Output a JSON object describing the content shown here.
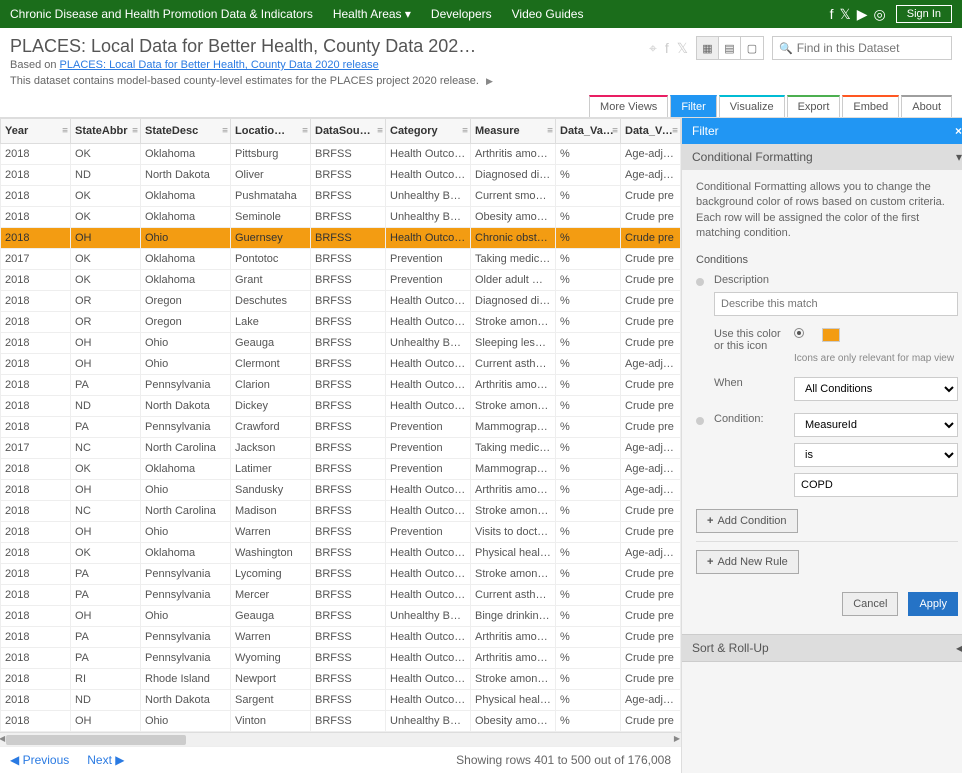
{
  "topnav": {
    "site_title": "Chronic Disease and Health Promotion Data & Indicators",
    "links": [
      "Health Areas",
      "Developers",
      "Video Guides"
    ],
    "signin": "Sign In"
  },
  "header": {
    "title": "PLACES: Local Data for Better Health, County Data 202…",
    "based_on_prefix": "Based on ",
    "based_on_link": "PLACES: Local Data for Better Health, County Data 2020 release",
    "description": "This dataset contains model-based county-level estimates for the PLACES project 2020 release.",
    "search_placeholder": "Find in this Dataset"
  },
  "tabs": {
    "more_views": "More Views",
    "filter": "Filter",
    "visualize": "Visualize",
    "export": "Export",
    "embed": "Embed",
    "about": "About"
  },
  "columns": [
    "Year",
    "StateAbbr",
    "StateDesc",
    "Locatio…",
    "DataSou…",
    "Category",
    "Measure",
    "Data_Va…",
    "Data_Va…"
  ],
  "rows": [
    {
      "c": [
        "2018",
        "OK",
        "Oklahoma",
        "Pittsburg",
        "BRFSS",
        "Health Outco…",
        "Arthritis amo…",
        "%",
        "Age-adjust"
      ]
    },
    {
      "c": [
        "2018",
        "ND",
        "North Dakota",
        "Oliver",
        "BRFSS",
        "Health Outco…",
        "Diagnosed di…",
        "%",
        "Age-adjust"
      ]
    },
    {
      "c": [
        "2018",
        "OK",
        "Oklahoma",
        "Pushmataha",
        "BRFSS",
        "Unhealthy Be…",
        "Current smo…",
        "%",
        "Crude pre"
      ]
    },
    {
      "c": [
        "2018",
        "OK",
        "Oklahoma",
        "Seminole",
        "BRFSS",
        "Unhealthy Be…",
        "Obesity amo…",
        "%",
        "Crude pre"
      ]
    },
    {
      "c": [
        "2018",
        "OH",
        "Ohio",
        "Guernsey",
        "BRFSS",
        "Health Outco…",
        "Chronic obst…",
        "%",
        "Crude pre"
      ],
      "hl": true
    },
    {
      "c": [
        "2017",
        "OK",
        "Oklahoma",
        "Pontotoc",
        "BRFSS",
        "Prevention",
        "Taking medic…",
        "%",
        "Crude pre"
      ]
    },
    {
      "c": [
        "2018",
        "OK",
        "Oklahoma",
        "Grant",
        "BRFSS",
        "Prevention",
        "Older adult …",
        "%",
        "Crude pre"
      ]
    },
    {
      "c": [
        "2018",
        "OR",
        "Oregon",
        "Deschutes",
        "BRFSS",
        "Health Outco…",
        "Diagnosed di…",
        "%",
        "Crude pre"
      ]
    },
    {
      "c": [
        "2018",
        "OR",
        "Oregon",
        "Lake",
        "BRFSS",
        "Health Outco…",
        "Stroke amon…",
        "%",
        "Crude pre"
      ]
    },
    {
      "c": [
        "2018",
        "OH",
        "Ohio",
        "Geauga",
        "BRFSS",
        "Unhealthy Be…",
        "Sleeping less …",
        "%",
        "Crude pre"
      ]
    },
    {
      "c": [
        "2018",
        "OH",
        "Ohio",
        "Clermont",
        "BRFSS",
        "Health Outco…",
        "Current asth…",
        "%",
        "Age-adjust"
      ]
    },
    {
      "c": [
        "2018",
        "PA",
        "Pennsylvania",
        "Clarion",
        "BRFSS",
        "Health Outco…",
        "Arthritis amo…",
        "%",
        "Crude pre"
      ]
    },
    {
      "c": [
        "2018",
        "ND",
        "North Dakota",
        "Dickey",
        "BRFSS",
        "Health Outco…",
        "Stroke amon…",
        "%",
        "Crude pre"
      ]
    },
    {
      "c": [
        "2018",
        "PA",
        "Pennsylvania",
        "Crawford",
        "BRFSS",
        "Prevention",
        "Mammograp…",
        "%",
        "Crude pre"
      ]
    },
    {
      "c": [
        "2017",
        "NC",
        "North Carolina",
        "Jackson",
        "BRFSS",
        "Prevention",
        "Taking medic…",
        "%",
        "Age-adjust"
      ]
    },
    {
      "c": [
        "2018",
        "OK",
        "Oklahoma",
        "Latimer",
        "BRFSS",
        "Prevention",
        "Mammograp…",
        "%",
        "Age-adjust"
      ]
    },
    {
      "c": [
        "2018",
        "OH",
        "Ohio",
        "Sandusky",
        "BRFSS",
        "Health Outco…",
        "Arthritis amo…",
        "%",
        "Age-adjust"
      ]
    },
    {
      "c": [
        "2018",
        "NC",
        "North Carolina",
        "Madison",
        "BRFSS",
        "Health Outco…",
        "Stroke amon…",
        "%",
        "Crude pre"
      ]
    },
    {
      "c": [
        "2018",
        "OH",
        "Ohio",
        "Warren",
        "BRFSS",
        "Prevention",
        "Visits to doct…",
        "%",
        "Crude pre"
      ]
    },
    {
      "c": [
        "2018",
        "OK",
        "Oklahoma",
        "Washington",
        "BRFSS",
        "Health Outco…",
        "Physical heal…",
        "%",
        "Age-adjust"
      ]
    },
    {
      "c": [
        "2018",
        "PA",
        "Pennsylvania",
        "Lycoming",
        "BRFSS",
        "Health Outco…",
        "Stroke amon…",
        "%",
        "Crude pre"
      ]
    },
    {
      "c": [
        "2018",
        "PA",
        "Pennsylvania",
        "Mercer",
        "BRFSS",
        "Health Outco…",
        "Current asth…",
        "%",
        "Crude pre"
      ]
    },
    {
      "c": [
        "2018",
        "OH",
        "Ohio",
        "Geauga",
        "BRFSS",
        "Unhealthy Be…",
        "Binge drinkin…",
        "%",
        "Crude pre"
      ]
    },
    {
      "c": [
        "2018",
        "PA",
        "Pennsylvania",
        "Warren",
        "BRFSS",
        "Health Outco…",
        "Arthritis amo…",
        "%",
        "Crude pre"
      ]
    },
    {
      "c": [
        "2018",
        "PA",
        "Pennsylvania",
        "Wyoming",
        "BRFSS",
        "Health Outco…",
        "Arthritis amo…",
        "%",
        "Crude pre"
      ]
    },
    {
      "c": [
        "2018",
        "RI",
        "Rhode Island",
        "Newport",
        "BRFSS",
        "Health Outco…",
        "Stroke amon…",
        "%",
        "Crude pre"
      ]
    },
    {
      "c": [
        "2018",
        "ND",
        "North Dakota",
        "Sargent",
        "BRFSS",
        "Health Outco…",
        "Physical heal…",
        "%",
        "Age-adjust"
      ]
    },
    {
      "c": [
        "2018",
        "OH",
        "Ohio",
        "Vinton",
        "BRFSS",
        "Unhealthy Be…",
        "Obesity amo…",
        "%",
        "Crude pre"
      ]
    }
  ],
  "pagination": {
    "prev": "Previous",
    "next": "Next",
    "info": "Showing rows 401 to 500 out of 176,008"
  },
  "panel": {
    "title": "Filter",
    "cond_format_header": "Conditional Formatting",
    "cond_format_desc": "Conditional Formatting allows you to change the background color of rows based on custom criteria. Each row will be assigned the color of the first matching condition.",
    "conditions_label": "Conditions",
    "desc_label": "Description",
    "desc_placeholder": "Describe this match",
    "use_color_label": "Use this color or this icon",
    "icon_note": "Icons are only relevant for map view",
    "when_label": "When",
    "when_value": "All Conditions",
    "condition_label": "Condition:",
    "cond_field": "MeasureId",
    "cond_op": "is",
    "cond_value": "COPD",
    "add_condition": "Add Condition",
    "add_rule": "Add New Rule",
    "cancel": "Cancel",
    "apply": "Apply",
    "sort_rollup": "Sort & Roll-Up"
  },
  "colors": {
    "highlight": "#f39c12",
    "primary": "#2196F3"
  }
}
